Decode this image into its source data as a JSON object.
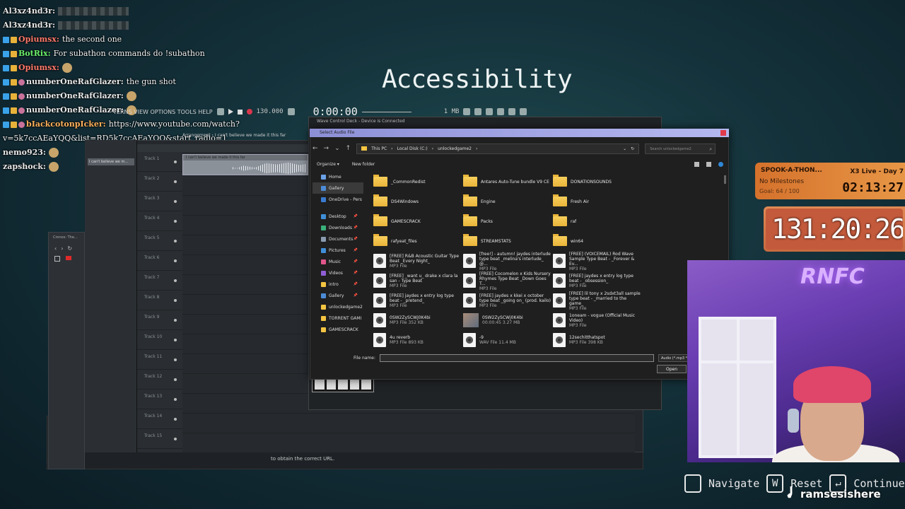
{
  "scene_title": "Accessibility",
  "chat": [
    {
      "user": "Al3xz4nd3r:",
      "color": "#e8e8e8",
      "badges": [],
      "message": "",
      "emote": "wide"
    },
    {
      "user": "Al3xz4nd3r:",
      "color": "#e8e8e8",
      "badges": [],
      "message": "",
      "emote": "wide"
    },
    {
      "user": "Opiumsx:",
      "color": "#ff7a6b",
      "badges": [
        "blue",
        "gold"
      ],
      "message": "the second one",
      "emote": ""
    },
    {
      "user": "BotRix:",
      "color": "#6cf06c",
      "badges": [
        "blue",
        "gold"
      ],
      "message": "For subathon commands do !subathon",
      "emote": ""
    },
    {
      "user": "Opiumsx:",
      "color": "#ff7a6b",
      "badges": [
        "blue",
        "gold"
      ],
      "message": "",
      "emote": "face"
    },
    {
      "user": "numberOneRafGlazer:",
      "color": "#e8e8e8",
      "badges": [
        "blue",
        "gold",
        "pink"
      ],
      "message": "the gun shot",
      "emote": ""
    },
    {
      "user": "numberOneRafGlazer:",
      "color": "#e8e8e8",
      "badges": [
        "blue",
        "gold",
        "pink"
      ],
      "message": "",
      "emote": "face"
    },
    {
      "user": "numberOneRafGlazer:",
      "color": "#e8e8e8",
      "badges": [
        "blue",
        "gold",
        "pink"
      ],
      "message": "",
      "emote": "face"
    },
    {
      "user": "bIackcotonpIcker:",
      "color": "#ffb15a",
      "badges": [
        "blue",
        "gold",
        "pink"
      ],
      "message": "https://www.youtube.com/watch?",
      "emote": ""
    },
    {
      "user": "",
      "color": "#e8e8e8",
      "badges": [],
      "message": "v=5k7ccAEaYQQ&list=RD5k7ccAEaYQQ&start_radio=1",
      "emote": ""
    },
    {
      "user": "nemo923:",
      "color": "#e8e8e8",
      "badges": [],
      "message": "",
      "emote": "face"
    },
    {
      "user": "zapshock:",
      "color": "#e8e8e8",
      "badges": [],
      "message": "",
      "emote": "face"
    }
  ],
  "daw": {
    "menu": "TERNS VIEW OPTIONS TOOLS HELP",
    "tempo": "130.000",
    "time": "0:00:00",
    "memory": "1 MB",
    "arrangement_title": "Arrangement › I can't believe we made it this far",
    "browser_clip": "I can't believe we m...",
    "clip_label": "I can't believe we made it this far",
    "tracks": [
      "Track 1",
      "Track 2",
      "Track 3",
      "Track 4",
      "Track 5",
      "Track 6",
      "Track 7",
      "Track 8",
      "Track 9",
      "Track 10",
      "Track 11",
      "Track 12",
      "Track 13",
      "Track 14",
      "Track 15"
    ]
  },
  "bg_browser_tab": "Cronos: The...",
  "status_url": "to obtain the correct URL.",
  "deck_title": "Wave Control Deck - Device is Connected",
  "dialog": {
    "title": "Select Audio File",
    "breadcrumbs": [
      "This PC",
      "Local Disk (C:)",
      "unlockedgame2"
    ],
    "search_placeholder": "Search unlockedgame2",
    "organize": "Organize ▾",
    "new_folder": "New folder",
    "sidebar": [
      {
        "label": "Home",
        "color": "#6aa0e6",
        "pin": false,
        "sel": false
      },
      {
        "label": "Gallery",
        "color": "#4c8bd6",
        "pin": false,
        "sel": true
      },
      {
        "label": "OneDrive - Pers",
        "color": "#3a7bd0",
        "pin": false,
        "sel": false
      },
      {
        "label": "",
        "color": "",
        "pin": false,
        "sel": false
      },
      {
        "label": "Desktop",
        "color": "#3f8fd8",
        "pin": true,
        "sel": false
      },
      {
        "label": "Downloads",
        "color": "#3ab07a",
        "pin": true,
        "sel": false
      },
      {
        "label": "Documents",
        "color": "#8a9bb0",
        "pin": true,
        "sel": false
      },
      {
        "label": "Pictures",
        "color": "#3f8fd8",
        "pin": true,
        "sel": false
      },
      {
        "label": "Music",
        "color": "#e0568a",
        "pin": true,
        "sel": false
      },
      {
        "label": "Videos",
        "color": "#8f5fd6",
        "pin": true,
        "sel": false
      },
      {
        "label": "intro",
        "color": "#f5c542",
        "pin": true,
        "sel": false
      },
      {
        "label": "Gallery",
        "color": "#4c8bd6",
        "pin": true,
        "sel": false
      },
      {
        "label": "unlockedgame2",
        "color": "#f5c542",
        "pin": false,
        "sel": false
      },
      {
        "label": "TORRENT GAMI",
        "color": "#f5c542",
        "pin": false,
        "sel": false
      },
      {
        "label": "GAMESCRACK",
        "color": "#f5c542",
        "pin": false,
        "sel": false
      }
    ],
    "files": [
      {
        "kind": "folder",
        "name": "_CommonRedist",
        "meta": ""
      },
      {
        "kind": "folder",
        "name": "Antares Auto-Tune bundle V9 CE",
        "meta": ""
      },
      {
        "kind": "folder",
        "name": "DONATIONSOUNDS",
        "meta": ""
      },
      {
        "kind": "folder",
        "name": "DS4Windows",
        "meta": ""
      },
      {
        "kind": "folder",
        "name": "Engine",
        "meta": ""
      },
      {
        "kind": "folder",
        "name": "Fresh Air",
        "meta": ""
      },
      {
        "kind": "folder",
        "name": "GAMESCRACK",
        "meta": ""
      },
      {
        "kind": "folder",
        "name": "Packs",
        "meta": ""
      },
      {
        "kind": "folder",
        "name": "raf",
        "meta": ""
      },
      {
        "kind": "folder",
        "name": "rafyeat_files",
        "meta": ""
      },
      {
        "kind": "folder",
        "name": "STREAMSTATS",
        "meta": ""
      },
      {
        "kind": "folder",
        "name": "win64",
        "meta": ""
      },
      {
        "kind": "mp3",
        "name": "[FREE] R&B Acoustic Guitar Type Beat _Every Night_",
        "meta": "MP3 File"
      },
      {
        "kind": "mp3",
        "name": "[free!] - autumn! jaydes interlude type beat _melina's interlude_ @...",
        "meta": "MP3 File"
      },
      {
        "kind": "mp3",
        "name": "[FREE] (VOICEMAIL) Rod Wave Sample Type Beat - _Forever & Ev...",
        "meta": "MP3 File"
      },
      {
        "kind": "mp3",
        "name": "[FREE] _want u_ drake x clara la san - Type Beat",
        "meta": "MP3 File"
      },
      {
        "kind": "mp3",
        "name": "[FREE] Cocomelon x Kids Nursery Rhymes Type Beat _Down Goes T...",
        "meta": "MP3 File"
      },
      {
        "kind": "mp3",
        "name": "[FREE] jaydes x entry log type beat - _obsession_",
        "meta": "MP3 File"
      },
      {
        "kind": "mp3",
        "name": "[FREE] jaydes x entry log type beat - _pretend_",
        "meta": "MP3 File"
      },
      {
        "kind": "mp3",
        "name": "[FREE] jaydes x kkei x october type beat _going on_ (prod. kailo)",
        "meta": "MP3 File"
      },
      {
        "kind": "mp3",
        "name": "[FREE] lil tony x 2sdxt3all sample type beat - _married to the game_",
        "meta": "MP3 File"
      },
      {
        "kind": "mp3",
        "name": "0SW2ZySCWj0K4bi",
        "meta": "MP3 File 352 KB"
      },
      {
        "kind": "thumb",
        "name": "0SW2ZySCWj0K4bi",
        "meta": "00:00:45 3.27 MB"
      },
      {
        "kind": "mp3",
        "name": "1oneam - vogue (Official Music Video)",
        "meta": "MP3 File"
      },
      {
        "kind": "mp3",
        "name": "4u reverb",
        "meta": "MP3 File 893 KB"
      },
      {
        "kind": "mp3",
        "name": "-9",
        "meta": "WAV File 11.4 MB"
      },
      {
        "kind": "mp3",
        "name": "12sechitthatspot",
        "meta": "MP3 File 398 KB"
      }
    ],
    "file_name_label": "File name:",
    "file_name_value": "",
    "filter": "Audio (*.mp3 *",
    "open": "Open"
  },
  "subathon": {
    "title": "SPOOK-A-THON...",
    "milestones": "No Milestones",
    "goal": "Goal: 64 / 100",
    "live_label": "X3 Live - Day 7",
    "live_time": "02:13:27",
    "countdown": "131:20:26"
  },
  "webcam_sign": "RNFC",
  "bottom_hints": [
    {
      "key": "",
      "label": "Navigate"
    },
    {
      "key": "W",
      "label": "Reset"
    },
    {
      "key": "↵",
      "label": "Continue"
    }
  ],
  "watermark": "ramsesishere"
}
